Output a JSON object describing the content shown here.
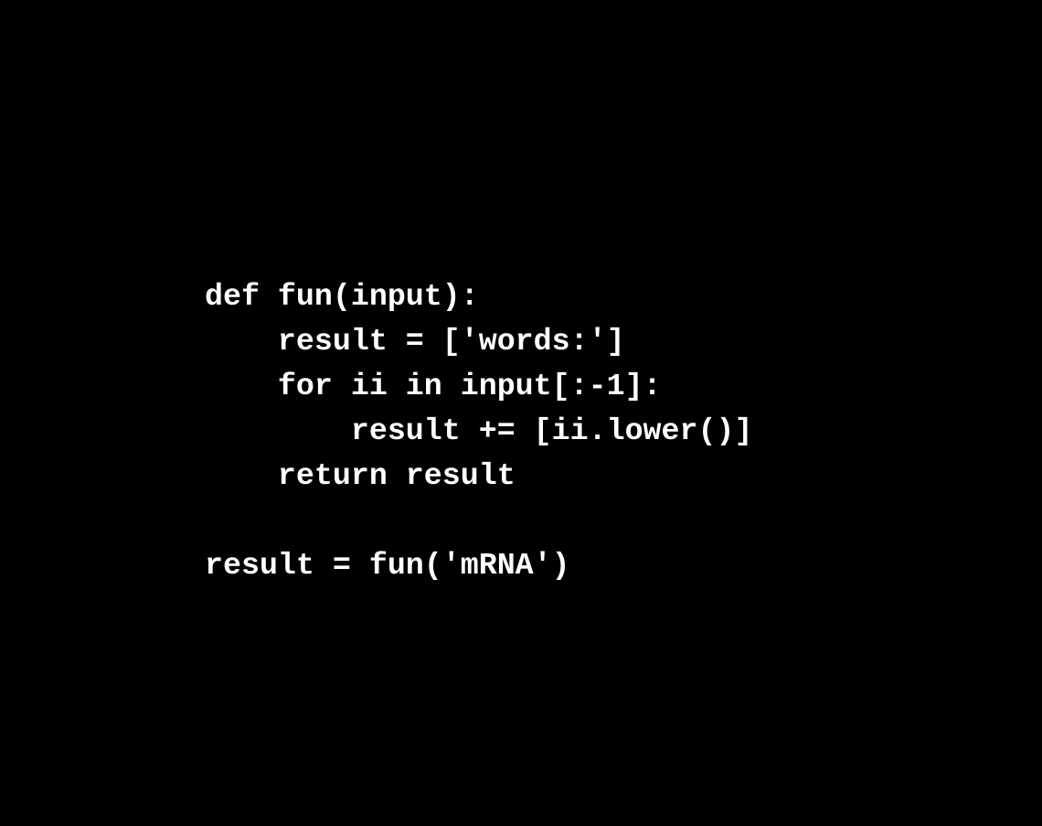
{
  "code": {
    "lines": [
      "def fun(input):",
      "    result = ['words:']",
      "    for ii in input[:-1]:",
      "        result += [ii.lower()]",
      "    return result",
      "",
      "result = fun('mRNA')"
    ]
  },
  "colors": {
    "background": "#000000",
    "text": "#ffffff"
  }
}
